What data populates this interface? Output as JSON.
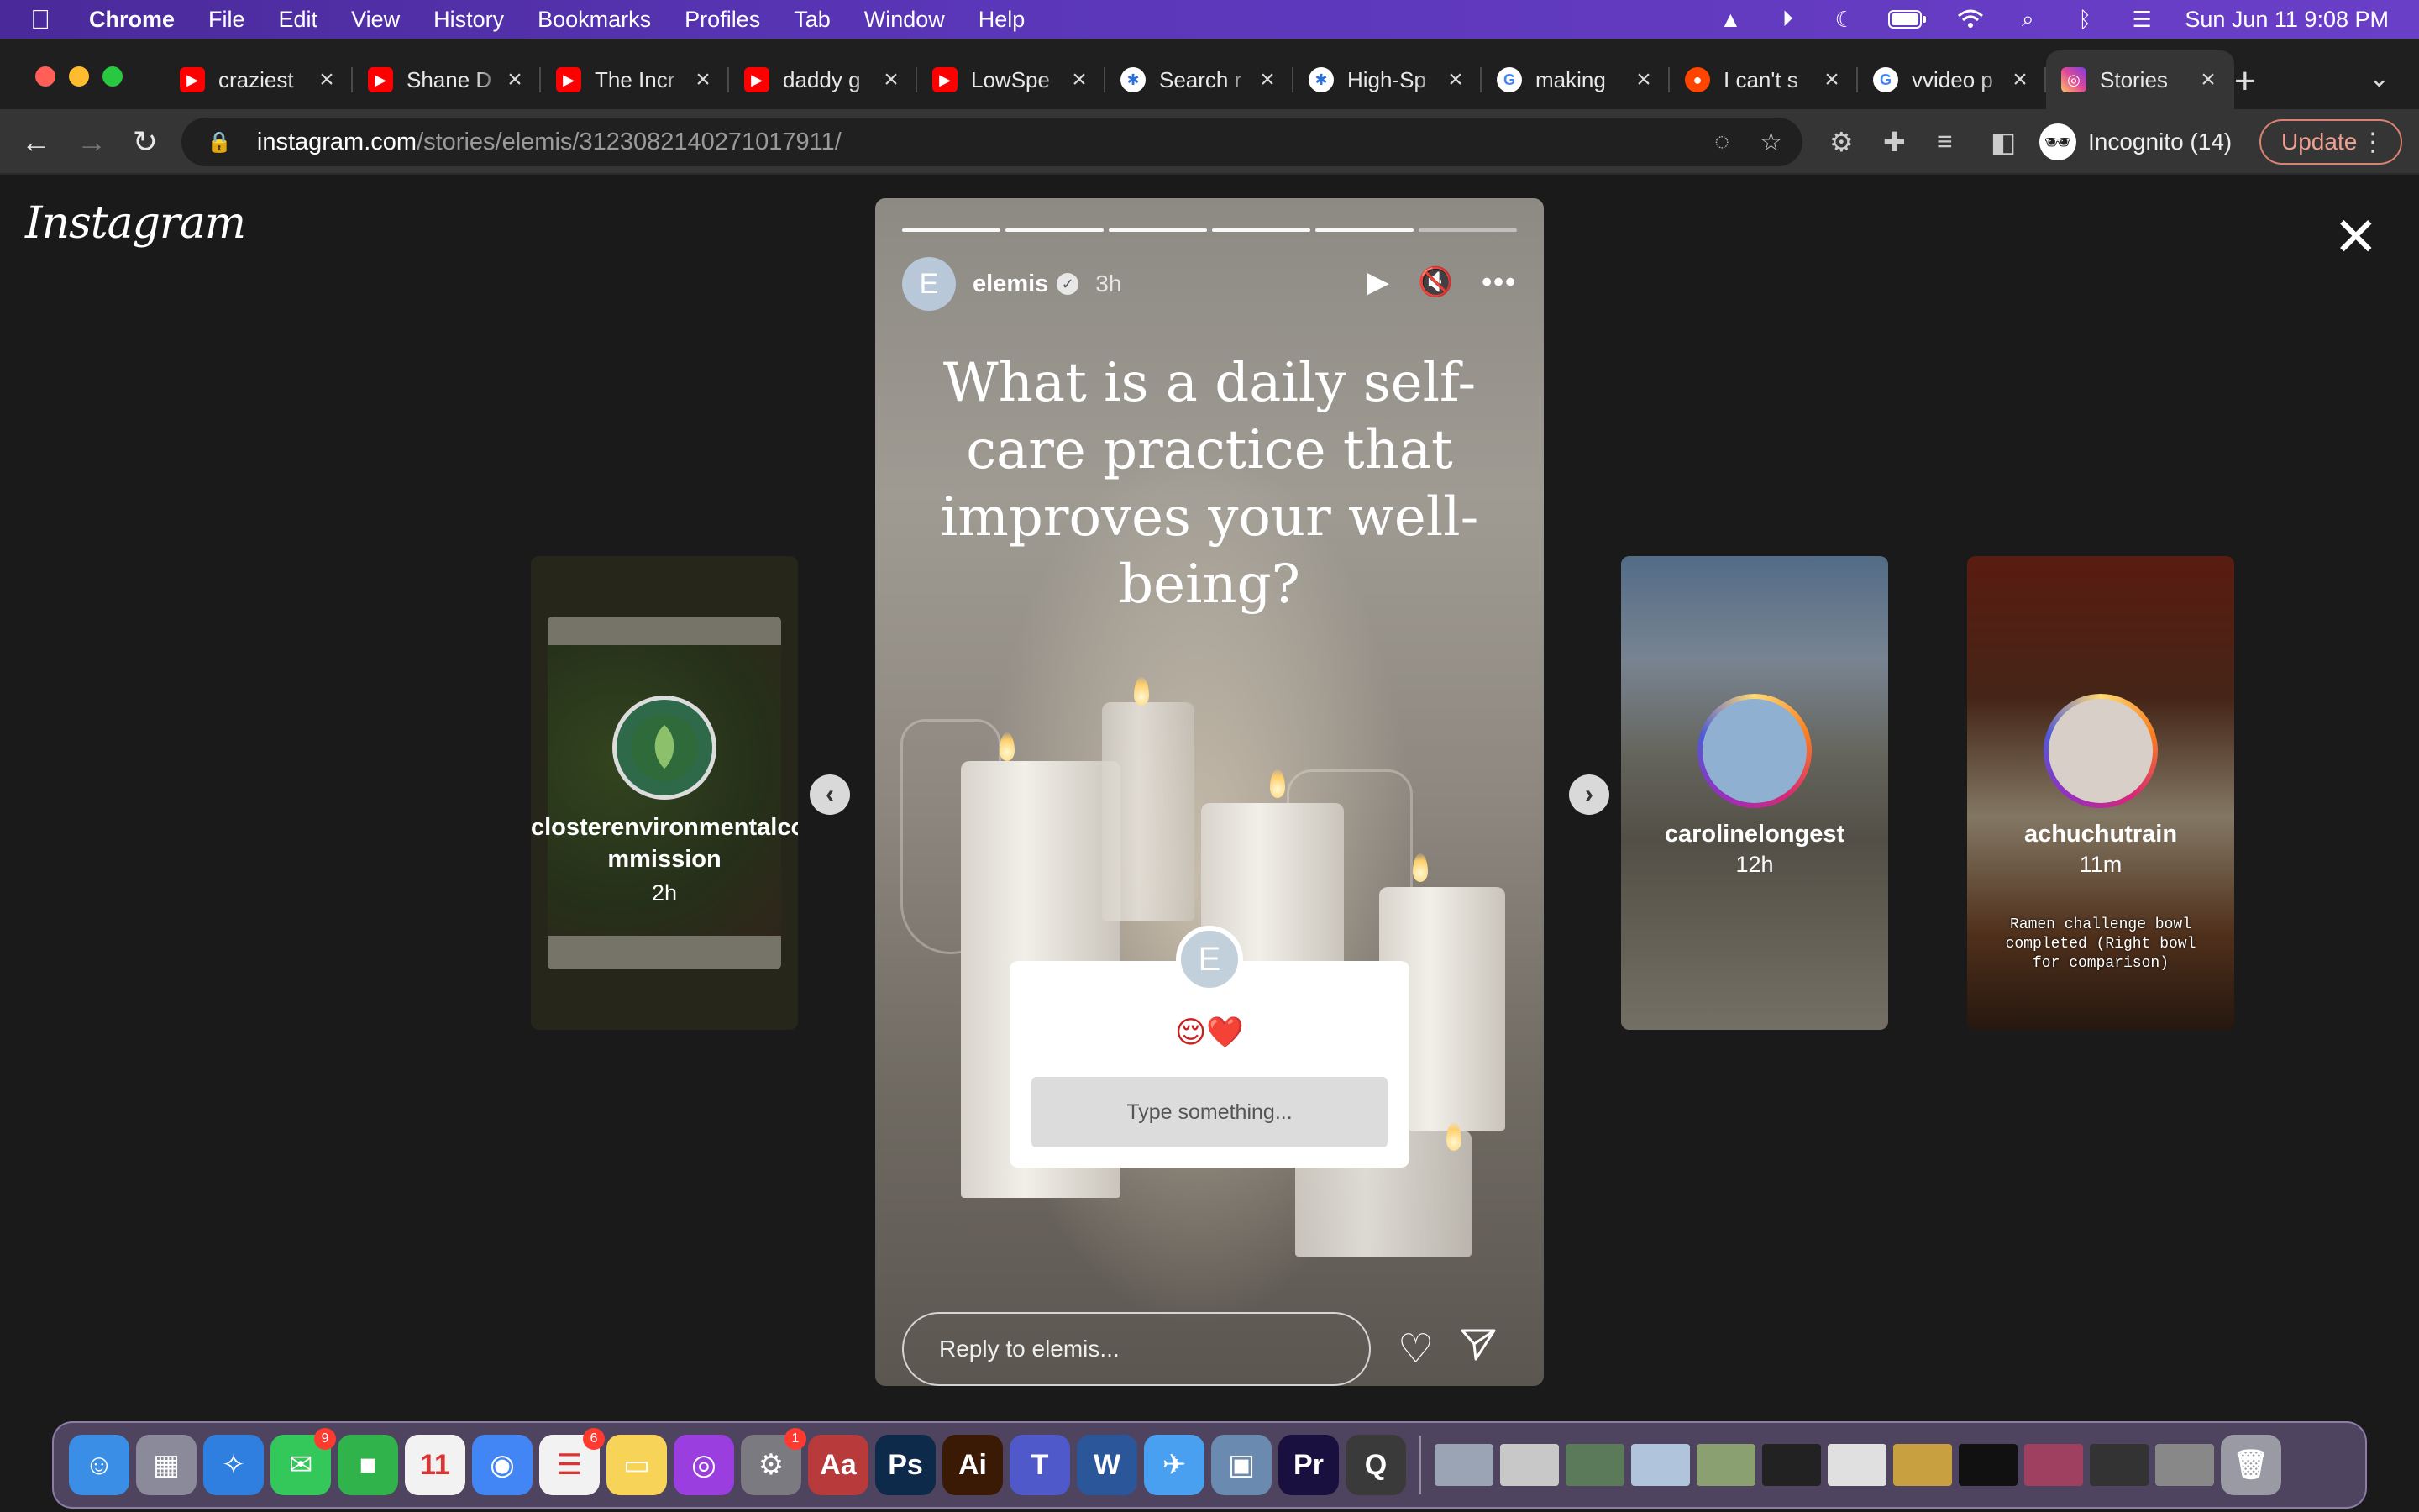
{
  "menubar": {
    "apple": "",
    "app": "Chrome",
    "items": [
      "File",
      "Edit",
      "View",
      "History",
      "Bookmarks",
      "Profiles",
      "Tab",
      "Window",
      "Help"
    ],
    "clock": "Sun Jun 11  9:08 PM"
  },
  "tabs": [
    {
      "title": "craziest",
      "favicon": "youtube-icon",
      "glyph": "▶"
    },
    {
      "title": "Shane D",
      "favicon": "youtube-icon",
      "glyph": "▶"
    },
    {
      "title": "The Incr",
      "favicon": "youtube-icon",
      "glyph": "▶"
    },
    {
      "title": "daddy g",
      "favicon": "youtube-icon",
      "glyph": "▶"
    },
    {
      "title": "LowSpe",
      "favicon": "youtube-icon",
      "glyph": "▶"
    },
    {
      "title": "Search r",
      "favicon": "search-icon",
      "glyph": "✱"
    },
    {
      "title": "High-Sp",
      "favicon": "search-icon",
      "glyph": "✱"
    },
    {
      "title": "making",
      "favicon": "google-icon",
      "glyph": "G"
    },
    {
      "title": "I can't s",
      "favicon": "reddit-icon",
      "glyph": "●"
    },
    {
      "title": "vvideo p",
      "favicon": "google-icon",
      "glyph": "G"
    },
    {
      "title": "Stories",
      "favicon": "instagram-icon",
      "glyph": "◎",
      "active": true
    }
  ],
  "toolbar": {
    "url_host": "instagram.com",
    "url_path": "/stories/elemis/3123082140271017911/",
    "incognito_label": "Incognito (14)",
    "update_label": "Update"
  },
  "instagram": {
    "logo": "Instagram",
    "story": {
      "username": "elemis",
      "avatar_letter": "E",
      "age": "3h",
      "question": "What is a daily self-care practice that improves your well-being?",
      "emoji": "😌❤️",
      "answer_placeholder": "Type something...",
      "reply_placeholder": "Reply to elemis...",
      "progress_segments": 6
    },
    "thumbnails": [
      {
        "username": "closterenvironmentalcommission",
        "line1": "closterenvironmentalco",
        "line2": "mmission",
        "age": "2h",
        "caption": ""
      },
      {
        "username": "carolinelongest",
        "age": "12h",
        "caption": ""
      },
      {
        "username": "achuchutrain",
        "age": "11m",
        "caption": "Ramen challenge bowl completed (Right bowl for comparison)"
      }
    ]
  },
  "dock": {
    "apps": [
      {
        "name": "finder",
        "color": "#3a8ee6",
        "glyph": "☺"
      },
      {
        "name": "launchpad",
        "color": "#8a8a9a",
        "glyph": "▦"
      },
      {
        "name": "safari",
        "color": "#2f7fe0",
        "glyph": "✧"
      },
      {
        "name": "messages",
        "color": "#34c759",
        "glyph": "✉",
        "badge": "9"
      },
      {
        "name": "facetime",
        "color": "#30b34a",
        "glyph": "■"
      },
      {
        "name": "calendar",
        "color": "#f2f2f2",
        "glyph": "11"
      },
      {
        "name": "chrome",
        "color": "#4285f4",
        "glyph": "◉"
      },
      {
        "name": "reminders",
        "color": "#f2f2f2",
        "glyph": "☰",
        "badge": "6"
      },
      {
        "name": "notes",
        "color": "#f7d358",
        "glyph": "▭"
      },
      {
        "name": "podcasts",
        "color": "#9b3ee0",
        "glyph": "◎"
      },
      {
        "name": "system-settings",
        "color": "#7a7a80",
        "glyph": "⚙",
        "badge": "1"
      },
      {
        "name": "dictionary",
        "color": "#b83a3a",
        "glyph": "Aa"
      },
      {
        "name": "photoshop",
        "color": "#0e2a4a",
        "glyph": "Ps"
      },
      {
        "name": "illustrator",
        "color": "#3a1a05",
        "glyph": "Ai"
      },
      {
        "name": "teams",
        "color": "#5059c9",
        "glyph": "T"
      },
      {
        "name": "word",
        "color": "#2b579a",
        "glyph": "W"
      },
      {
        "name": "testflight",
        "color": "#4aa0f0",
        "glyph": "✈"
      },
      {
        "name": "preview",
        "color": "#6a8ab0",
        "glyph": "▣"
      },
      {
        "name": "premiere",
        "color": "#1a1040",
        "glyph": "Pr"
      },
      {
        "name": "quicktime",
        "color": "#3a3a3a",
        "glyph": "Q"
      }
    ],
    "windows": 12
  }
}
